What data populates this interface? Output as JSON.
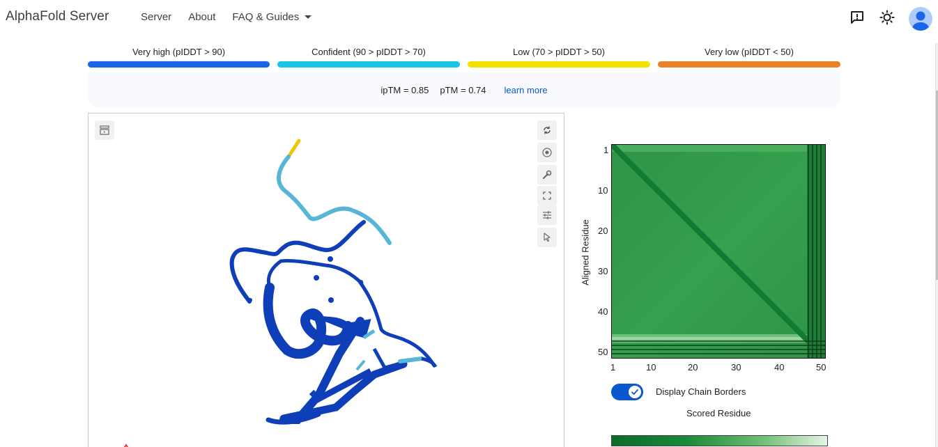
{
  "header": {
    "brand": "AlphaFold Server",
    "nav": [
      {
        "label": "Server"
      },
      {
        "label": "About"
      },
      {
        "label": "FAQ & Guides"
      }
    ]
  },
  "legend": [
    {
      "label": "Very high (pIDDT > 90)",
      "color": "#1a66e8"
    },
    {
      "label": "Confident (90 > pIDDT > 70)",
      "color": "#17c6e8"
    },
    {
      "label": "Low (70 > pIDDT > 50)",
      "color": "#f1e200"
    },
    {
      "label": "Very low (pIDDT < 50)",
      "color": "#e9822a"
    }
  ],
  "scores": {
    "iptm": "ipTM = 0.85",
    "ptm": "pTM = 0.74",
    "learn_more": "learn more"
  },
  "pae": {
    "y_ticks": [
      "1",
      "10",
      "20",
      "30",
      "40",
      "50"
    ],
    "x_ticks": [
      "1",
      "10",
      "20",
      "30",
      "40",
      "50"
    ],
    "y_axis_label": "Aligned Residue",
    "toggle_label": "Display Chain Borders",
    "toggle_on": true,
    "x_axis_label": "Scored Residue"
  },
  "colors": {
    "accent": "#0b57d0",
    "structure_blue": "#0e3fb8",
    "structure_light": "#57b5d6",
    "structure_yellow": "#f1c600"
  }
}
